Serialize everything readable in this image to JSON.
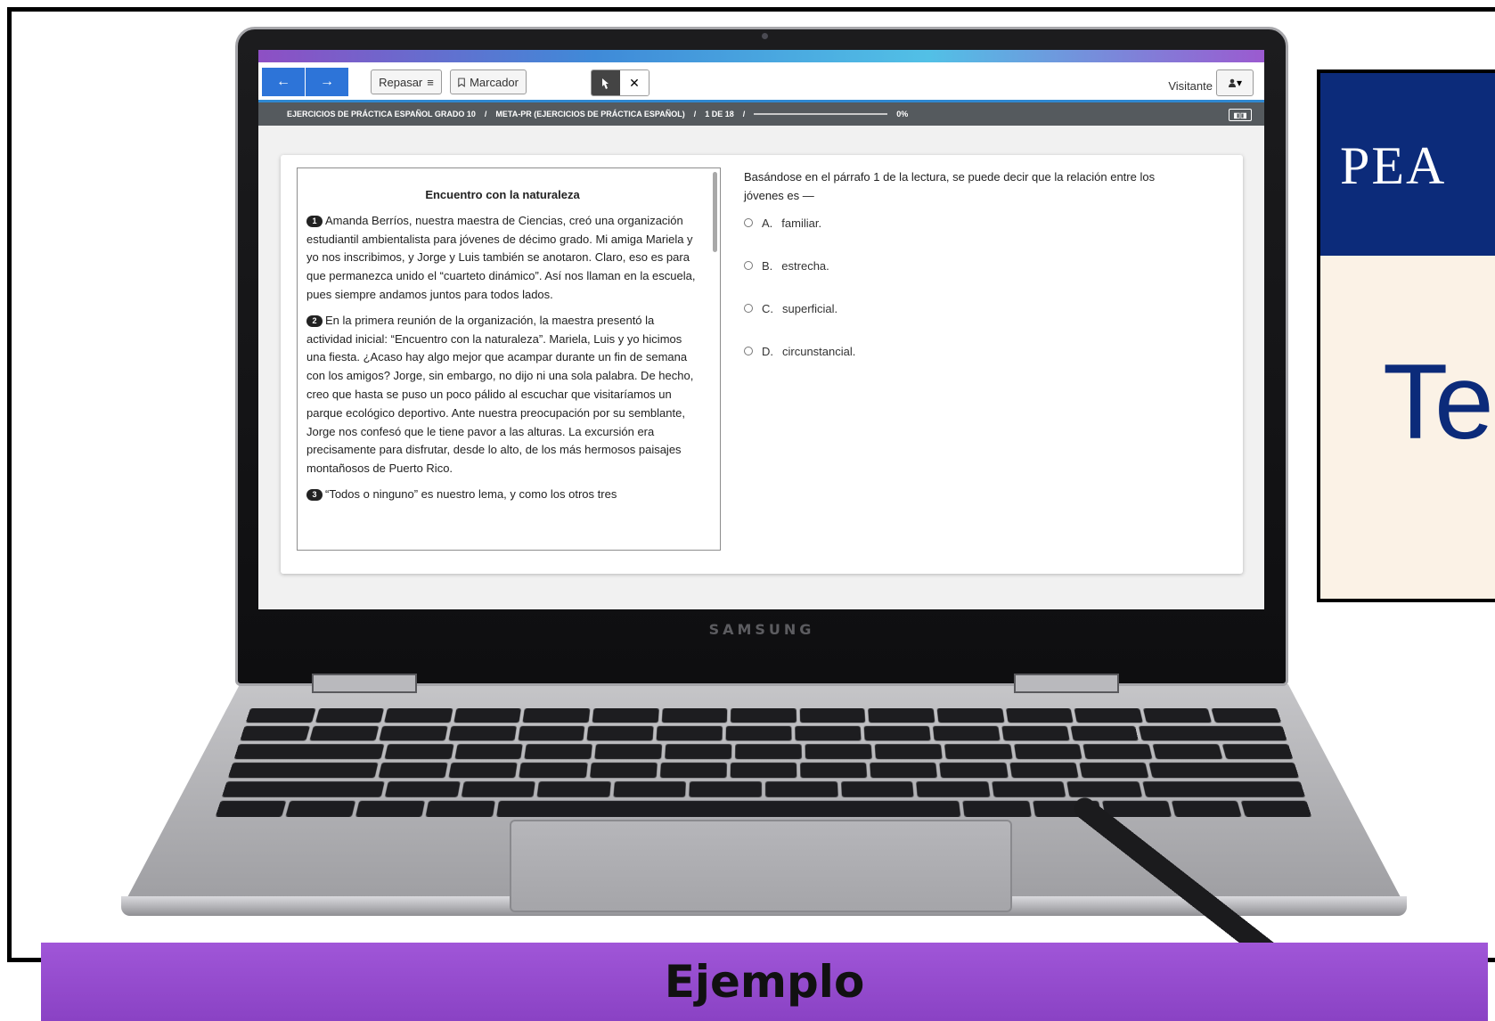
{
  "pearson": {
    "logo": "PEA",
    "headline": "Te"
  },
  "laptop": {
    "brand": "SAMSUNG"
  },
  "toolbar": {
    "back_icon": "←",
    "forward_icon": "→",
    "review_label": "Repasar",
    "review_icon": "≡",
    "bookmark_label": "Marcador",
    "bookmark_icon": "bookmark-icon",
    "pointer_icon": "pointer-icon",
    "close_icon": "✕",
    "visitor_label": "Visitante",
    "user_icon": "user-icon",
    "caret": "▾"
  },
  "breadcrumb": {
    "course": "EJERCICIOS DE PRÁCTICA ESPAÑOL GRADO 10",
    "sep1": "/",
    "test": "META-PR (EJERCICIOS DE PRÁCTICA ESPAÑOL)",
    "sep2": "/",
    "page": "1 DE 18",
    "sep3": "/",
    "progress": "0%",
    "toggle": "◧◨"
  },
  "passage": {
    "title": "Encuentro con la naturaleza",
    "paragraphs": [
      {
        "num": "1",
        "text": "Amanda Berríos, nuestra maestra de Ciencias, creó una organización estudiantil ambientalista para jóvenes de décimo grado. Mi amiga Mariela y yo nos inscribimos, y Jorge y Luis también se anotaron. Claro, eso es para que permanezca unido el “cuarteto dinámico”. Así nos llaman en la escuela, pues siempre andamos juntos para todos lados."
      },
      {
        "num": "2",
        "text": "En la primera reunión de la organización, la maestra presentó la actividad inicial: “Encuentro con la naturaleza”. Mariela, Luis y yo hicimos una fiesta. ¿Acaso hay algo mejor que acampar durante un fin de semana con los amigos? Jorge, sin embargo, no dijo ni una sola palabra. De hecho, creo que hasta se puso un poco pálido al escuchar que visitaríamos un parque ecológico deportivo. Ante nuestra preocupación por su semblante, Jorge nos confesó que le tiene pavor a las alturas. La excursión era precisamente para disfrutar, desde lo alto, de los más hermosos paisajes montañosos de Puerto Rico."
      },
      {
        "num": "3",
        "text": "“Todos o ninguno” es nuestro lema, y como los otros tres"
      }
    ]
  },
  "question": {
    "stem": "Basándose en el párrafo 1 de la lectura, se puede decir que la relación entre los jóvenes es —",
    "options": [
      {
        "letter": "A.",
        "text": "familiar."
      },
      {
        "letter": "B.",
        "text": "estrecha."
      },
      {
        "letter": "C.",
        "text": "superficial."
      },
      {
        "letter": "D.",
        "text": "circunstancial."
      }
    ]
  },
  "banner": {
    "label": "Ejemplo"
  },
  "progress_fraction": 0
}
